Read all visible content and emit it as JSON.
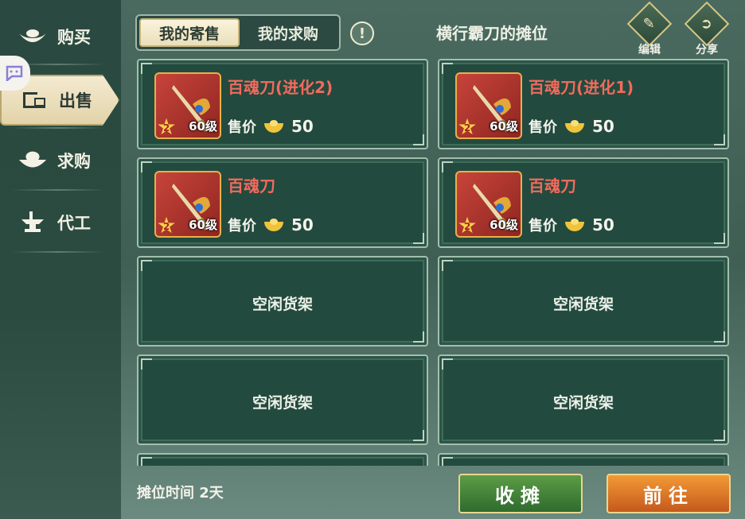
{
  "sidebar": {
    "items": [
      {
        "label": "购买",
        "icon": "ingot-icon"
      },
      {
        "label": "出售",
        "icon": "stall-icon",
        "active": true
      },
      {
        "label": "求购",
        "icon": "bowl-icon"
      },
      {
        "label": "代工",
        "icon": "anvil-icon"
      }
    ]
  },
  "header": {
    "tabs": [
      {
        "label": "我的寄售",
        "active": true
      },
      {
        "label": "我的求购",
        "active": false
      }
    ],
    "title": "横行霸刀的摊位",
    "edit_label": "编辑",
    "share_label": "分享"
  },
  "slots": [
    {
      "name": "百魂刀(进化2)",
      "star": "2",
      "level": "60级",
      "price_label": "售价",
      "price": "50"
    },
    {
      "name": "百魂刀(进化1)",
      "star": "2",
      "level": "60级",
      "price_label": "售价",
      "price": "50"
    },
    {
      "name": "百魂刀",
      "star": "2",
      "level": "60级",
      "price_label": "售价",
      "price": "50"
    },
    {
      "name": "百魂刀",
      "star": "2",
      "level": "60级",
      "price_label": "售价",
      "price": "50"
    },
    {
      "empty": "空闲货架"
    },
    {
      "empty": "空闲货架"
    },
    {
      "empty": "空闲货架"
    },
    {
      "empty": "空闲货架"
    }
  ],
  "footer": {
    "stall_time": "摊位时间 2天",
    "close_stall": "收摊",
    "go": "前往"
  }
}
